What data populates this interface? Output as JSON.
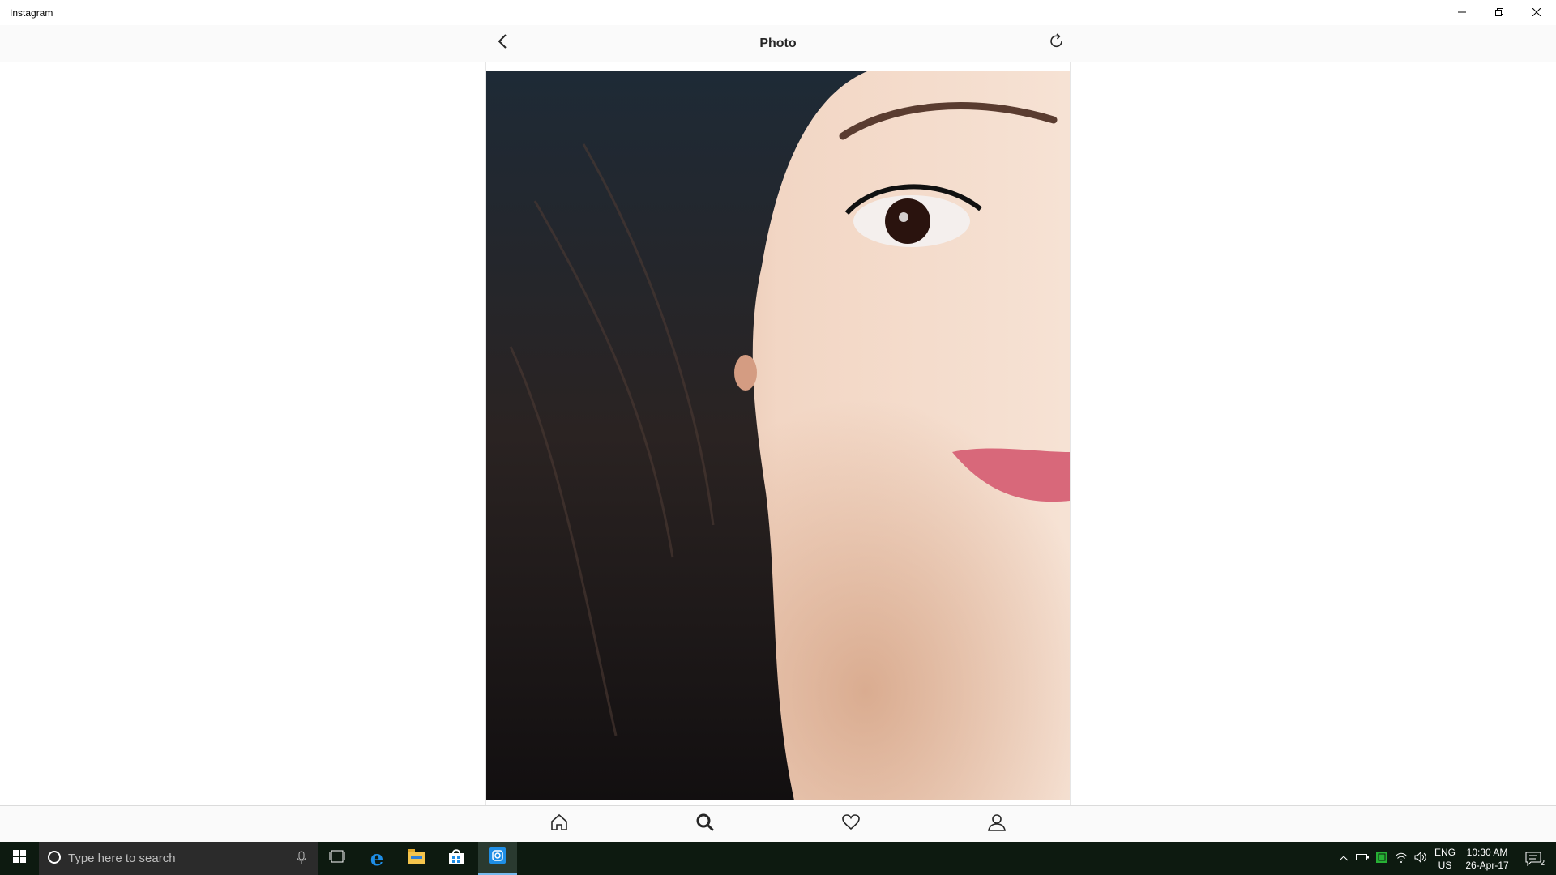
{
  "window": {
    "title": "Instagram",
    "minimize_icon": "minimize-icon",
    "maximize_icon": "restore-icon",
    "close_icon": "close-icon"
  },
  "appbar": {
    "title": "Photo",
    "back_icon": "chevron-left-icon",
    "refresh_icon": "refresh-icon"
  },
  "bottom_nav": {
    "items": [
      {
        "name": "home",
        "icon": "home-icon"
      },
      {
        "name": "search",
        "icon": "search-icon",
        "active": true
      },
      {
        "name": "activity",
        "icon": "heart-icon"
      },
      {
        "name": "profile",
        "icon": "person-icon"
      }
    ]
  },
  "taskbar": {
    "search_placeholder": "Type here to search",
    "pinned": [
      "task-view-icon",
      "edge-icon",
      "file-explorer-icon",
      "store-icon",
      "instagram-icon"
    ],
    "tray": {
      "language": "ENG",
      "region": "US",
      "time": "10:30 AM",
      "date": "26-Apr-17",
      "notification_count": "2"
    }
  },
  "colors": {
    "taskbar_bg": "#0d1a10",
    "appbar_bg": "#fafafa",
    "accent": "#76b9ed"
  }
}
